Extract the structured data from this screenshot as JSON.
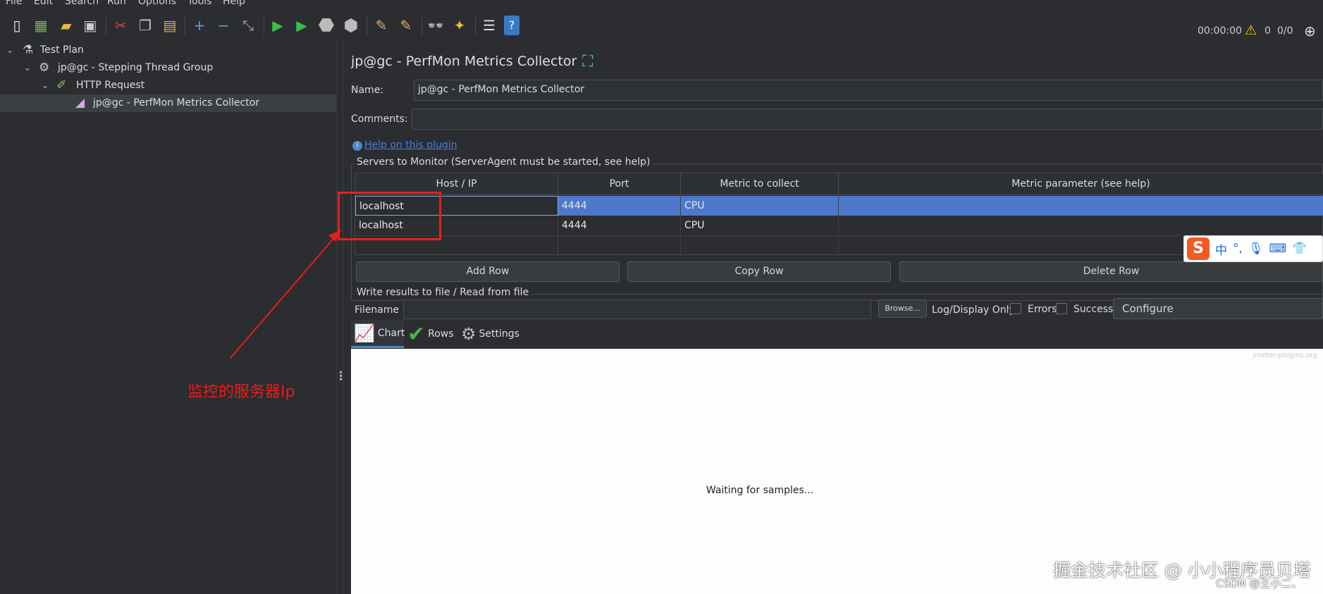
{
  "menu": {
    "file": "File",
    "edit": "Edit",
    "search": "Search",
    "run": "Run",
    "options": "Options",
    "tools": "Tools",
    "help": "Help"
  },
  "toolbar": {
    "timer": "00:00:00",
    "warning_count": "0",
    "thread_count": "0/0"
  },
  "tree": {
    "items": [
      {
        "label": "Test Plan",
        "icon": "flask-icon"
      },
      {
        "label": "jp@gc - Stepping Thread Group",
        "icon": "gear-icon"
      },
      {
        "label": "HTTP Request",
        "icon": "pen-icon"
      },
      {
        "label": "jp@gc - PerfMon Metrics Collector",
        "icon": "chart-icon"
      }
    ]
  },
  "panel": {
    "title": "jp@gc - PerfMon Metrics Collector",
    "name_label": "Name:",
    "name_value": "jp@gc - PerfMon Metrics Collector",
    "comments_label": "Comments:",
    "comments_value": "",
    "help_link": "Help on this plugin",
    "servers_group": "Servers to Monitor (ServerAgent must be started, see help)",
    "columns": [
      "Host / IP",
      "Port",
      "Metric to collect",
      "Metric parameter (see help)"
    ],
    "rows": [
      {
        "host": "localhost",
        "port": "4444",
        "metric": "CPU",
        "param": ""
      },
      {
        "host": "localhost",
        "port": "4444",
        "metric": "CPU",
        "param": ""
      }
    ],
    "add_row": "Add Row",
    "copy_row": "Copy Row",
    "delete_row": "Delete Row",
    "file_group": "Write results to file / Read from file",
    "filename_label": "Filename",
    "filename_value": "",
    "browse": "Browse...",
    "log_display": "Log/Display Only:",
    "errors": "Errors",
    "successes": "Successes",
    "configure": "Configure",
    "tabs": [
      {
        "label": "Chart"
      },
      {
        "label": "Rows"
      },
      {
        "label": "Settings"
      }
    ],
    "chart_watermark": "jmeter-plugins.org",
    "waiting": "Waiting for samples..."
  },
  "ime": {
    "lang": "中",
    "punct": "°,"
  },
  "annotation": {
    "text": "监控的服务器Ip",
    "color": "#e81c1c"
  },
  "watermarks": {
    "juejin": "掘金技术社区 @ 小小程序员贝塔",
    "csdn": "CSDN @王小二、"
  }
}
